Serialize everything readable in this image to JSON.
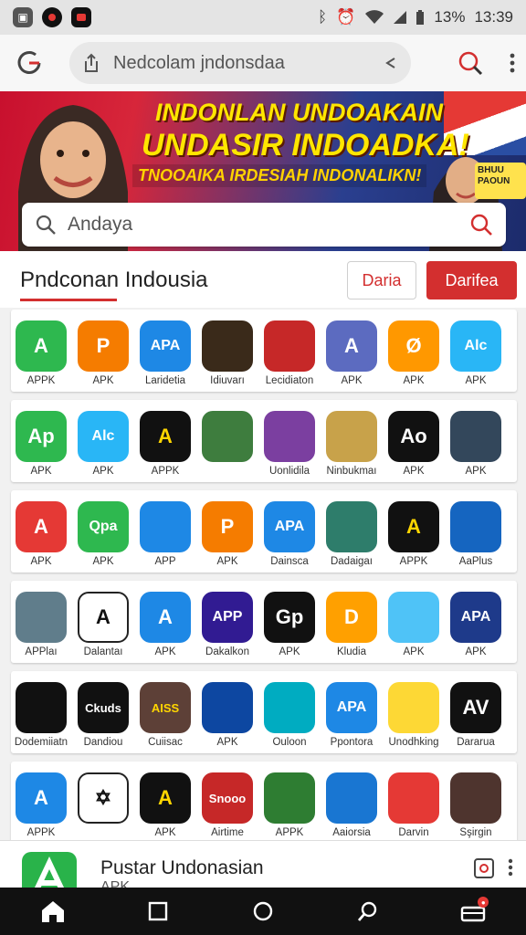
{
  "status_bar": {
    "time": "13:39",
    "battery": "13%",
    "icons": [
      "notification-icon",
      "record-icon",
      "message-icon",
      "bluetooth-icon",
      "alarm-icon",
      "wifi-icon",
      "signal-icon",
      "battery-icon"
    ]
  },
  "browser": {
    "url_text": "Nedcolam jndonsdaa",
    "logo": "browser-logo-icon"
  },
  "banner": {
    "line1": "INDONLAN UNDOAKAIN",
    "line2": "UNDASIR INDOADKA!",
    "line3": "TNOOAIKA IRDESIAH INDONALIKN!",
    "sign_text": "BHUU PAOUN",
    "search_placeholder": "Andaya"
  },
  "section": {
    "title": "Pndconan  Indousia",
    "button_outline": "Daria",
    "button_filled": "Darifea"
  },
  "app_rows": [
    [
      {
        "label": "APPK",
        "glyph": "A",
        "bg": "#2eb84f",
        "fg": "#ffffff"
      },
      {
        "label": "APK",
        "glyph": "P",
        "bg": "#f57c00",
        "fg": "#ffffff"
      },
      {
        "label": "Laridetia",
        "glyph": "APA",
        "bg": "#1e88e5",
        "fg": "#ffffff"
      },
      {
        "label": "Idiuvarı",
        "glyph": "",
        "bg": "#3a2a1a",
        "fg": "#ffcc00"
      },
      {
        "label": "Lecidiaton",
        "glyph": "",
        "bg": "#c62828",
        "fg": "#ffffff"
      },
      {
        "label": "APK",
        "glyph": "A",
        "bg": "#5c6bc0",
        "fg": "#ffffff"
      },
      {
        "label": "APK",
        "glyph": "Ø",
        "bg": "#ff9800",
        "fg": "#ffffff"
      },
      {
        "label": "APK",
        "glyph": "Alc",
        "bg": "#29b6f6",
        "fg": "#ffffff"
      }
    ],
    [
      {
        "label": "APK",
        "glyph": "Ap",
        "bg": "#2eb84f",
        "fg": "#ffffff"
      },
      {
        "label": "APK",
        "glyph": "Alc",
        "bg": "#29b6f6",
        "fg": "#ffffff"
      },
      {
        "label": "APPK",
        "glyph": "A",
        "bg": "#111111",
        "fg": "#ffd600"
      },
      {
        "label": "",
        "glyph": "",
        "bg": "#3e7d3e",
        "fg": "#ffffff"
      },
      {
        "label": "Uonlidila",
        "glyph": "",
        "bg": "#7b3fa0",
        "fg": "#ffffff"
      },
      {
        "label": "Ninbukmaı",
        "glyph": "",
        "bg": "#c8a24a",
        "fg": "#ffffff"
      },
      {
        "label": "APK",
        "glyph": "Ao",
        "bg": "#111111",
        "fg": "#ffffff"
      },
      {
        "label": "APK",
        "glyph": "",
        "bg": "#33475b",
        "fg": "#ffffff"
      }
    ],
    [
      {
        "label": "APK",
        "glyph": "A",
        "bg": "#e53935",
        "fg": "#ffffff"
      },
      {
        "label": "APK",
        "glyph": "Qpa",
        "bg": "#2eb84f",
        "fg": "#ffffff"
      },
      {
        "label": "APP",
        "glyph": "",
        "bg": "#1e88e5",
        "fg": "#ffd600"
      },
      {
        "label": "APK",
        "glyph": "P",
        "bg": "#f57c00",
        "fg": "#ffffff"
      },
      {
        "label": "Dainsca",
        "glyph": "APA",
        "bg": "#1e88e5",
        "fg": "#ffffff"
      },
      {
        "label": "Dadaigaı",
        "glyph": "",
        "bg": "#2e7d6b",
        "fg": "#ffffff"
      },
      {
        "label": "APPK",
        "glyph": "A",
        "bg": "#111111",
        "fg": "#ffd600"
      },
      {
        "label": "AaPlus",
        "glyph": "",
        "bg": "#1565c0",
        "fg": "#ffffff"
      }
    ],
    [
      {
        "label": "APPlaı",
        "glyph": "",
        "bg": "#607d8b",
        "fg": "#ffffff"
      },
      {
        "label": "Dalantaı",
        "glyph": "A",
        "bg": "#ffffff",
        "fg": "#111111"
      },
      {
        "label": "APK",
        "glyph": "A",
        "bg": "#1e88e5",
        "fg": "#ffffff"
      },
      {
        "label": "Dakalkon",
        "glyph": "APP",
        "bg": "#311b92",
        "fg": "#ffffff"
      },
      {
        "label": "APK",
        "glyph": "Gp",
        "bg": "#111111",
        "fg": "#ffffff"
      },
      {
        "label": "Kludia",
        "glyph": "D",
        "bg": "#ffa000",
        "fg": "#ffffff"
      },
      {
        "label": "APK",
        "glyph": "",
        "bg": "#4fc3f7",
        "fg": "#ffffff"
      },
      {
        "label": "APK",
        "glyph": "APA",
        "bg": "#1e3a8a",
        "fg": "#ffffff"
      }
    ],
    [
      {
        "label": "Dodemiiatn",
        "glyph": "",
        "bg": "#111111",
        "fg": "#ffd600"
      },
      {
        "label": "Dandiou",
        "glyph": "Ckuds",
        "bg": "#111111",
        "fg": "#ffffff"
      },
      {
        "label": "Cuiisac",
        "glyph": "AISS",
        "bg": "#5d4037",
        "fg": "#ffd600"
      },
      {
        "label": "APK",
        "glyph": "",
        "bg": "#0d47a1",
        "fg": "#ffffff"
      },
      {
        "label": "Ouloon",
        "glyph": "",
        "bg": "#00acc1",
        "fg": "#ffffff"
      },
      {
        "label": "Ppontora",
        "glyph": "APA",
        "bg": "#1e88e5",
        "fg": "#ffffff"
      },
      {
        "label": "Unodhking",
        "glyph": "",
        "bg": "#fdd835",
        "fg": "#333333"
      },
      {
        "label": "Dararua",
        "glyph": "AV",
        "bg": "#111111",
        "fg": "#ffffff"
      }
    ],
    [
      {
        "label": "APPK",
        "glyph": "A",
        "bg": "#1e88e5",
        "fg": "#ffffff"
      },
      {
        "label": "",
        "glyph": "✡",
        "bg": "#ffffff",
        "fg": "#111111"
      },
      {
        "label": "APK",
        "glyph": "A",
        "bg": "#111111",
        "fg": "#ffd600"
      },
      {
        "label": "Airtime",
        "glyph": "Snooo",
        "bg": "#c62828",
        "fg": "#ffffff"
      },
      {
        "label": "APPK",
        "glyph": "",
        "bg": "#2e7d32",
        "fg": "#ffffff"
      },
      {
        "label": "Aaiorsia",
        "glyph": "",
        "bg": "#1976d2",
        "fg": "#ffffff"
      },
      {
        "label": "Darvin",
        "glyph": "",
        "bg": "#e53935",
        "fg": "#ffffff"
      },
      {
        "label": "Sşirgin",
        "glyph": "",
        "bg": "#4e342e",
        "fg": "#ffffff"
      }
    ]
  ],
  "bottom_card": {
    "title": "Pustar Undonasian",
    "subtitle": "APK"
  },
  "colors": {
    "accent": "#d32f2f",
    "status_bg": "#e4e4e4"
  }
}
